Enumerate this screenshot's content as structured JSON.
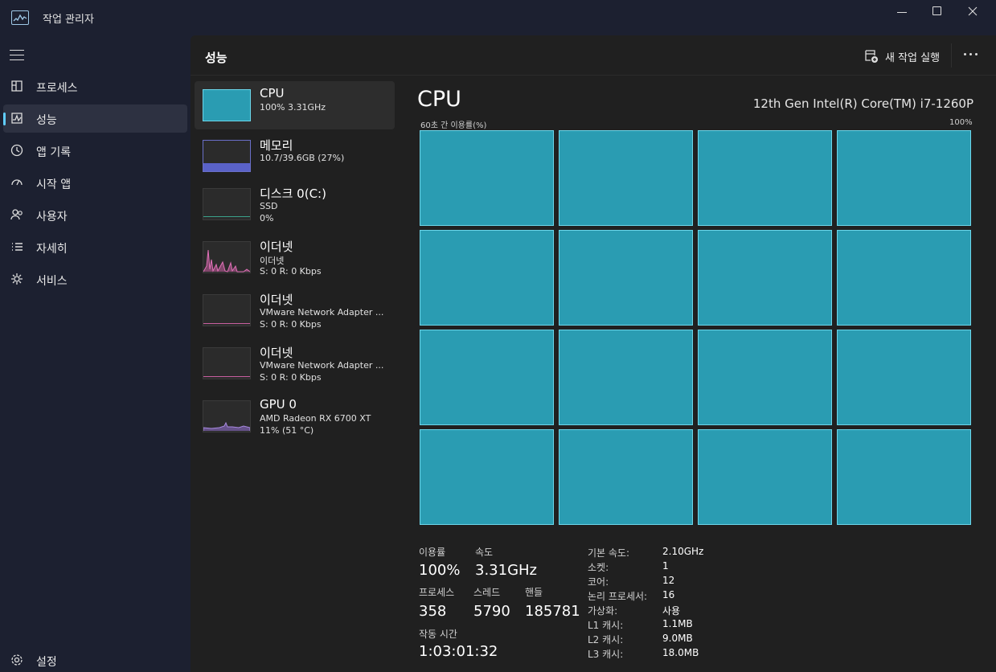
{
  "window": {
    "title": "작업 관리자"
  },
  "nav": {
    "items": [
      {
        "label": "프로세스",
        "icon": "processes-icon"
      },
      {
        "label": "성능",
        "icon": "performance-icon"
      },
      {
        "label": "앱 기록",
        "icon": "app-history-icon"
      },
      {
        "label": "시작 앱",
        "icon": "startup-icon"
      },
      {
        "label": "사용자",
        "icon": "users-icon"
      },
      {
        "label": "자세히",
        "icon": "details-icon"
      },
      {
        "label": "서비스",
        "icon": "services-icon"
      }
    ],
    "active_index": 1,
    "settings_label": "설정"
  },
  "header": {
    "title": "성능",
    "new_task_label": "새 작업 실행"
  },
  "devices": [
    {
      "name": "CPU",
      "sub1": "100%  3.31GHz",
      "sub2": ""
    },
    {
      "name": "메모리",
      "sub1": "10.7/39.6GB (27%)",
      "sub2": ""
    },
    {
      "name": "디스크 0(C:)",
      "sub1": "SSD",
      "sub2": "0%"
    },
    {
      "name": "이더넷",
      "sub1": "이더넷",
      "sub2": "S: 0  R: 0 Kbps"
    },
    {
      "name": "이더넷",
      "sub1": "VMware Network Adapter ...",
      "sub2": "S: 0  R: 0 Kbps"
    },
    {
      "name": "이더넷",
      "sub1": "VMware Network Adapter ...",
      "sub2": "S: 0  R: 0 Kbps"
    },
    {
      "name": "GPU 0",
      "sub1": "AMD Radeon RX 6700 XT",
      "sub2": "11% (51 °C)"
    }
  ],
  "cpu": {
    "title": "CPU",
    "model": "12th Gen Intel(R) Core(TM) i7-1260P",
    "graph_caption": "60초 간 이용률(%)",
    "graph_max": "100%",
    "logical_processor_graphs": 16,
    "graph_color": "#2a9cb2",
    "stats": {
      "utilization_label": "이용률",
      "utilization": "100%",
      "speed_label": "속도",
      "speed": "3.31GHz",
      "processes_label": "프로세스",
      "processes": "358",
      "threads_label": "스레드",
      "threads": "5790",
      "handles_label": "핸들",
      "handles": "185781",
      "uptime_label": "작동 시간",
      "uptime": "1:03:01:32"
    },
    "details": [
      {
        "key": "기본 속도:",
        "value": "2.10GHz"
      },
      {
        "key": "소켓:",
        "value": "1"
      },
      {
        "key": "코어:",
        "value": "12"
      },
      {
        "key": "논리 프로세서:",
        "value": "16"
      },
      {
        "key": "가상화:",
        "value": "사용"
      },
      {
        "key": "L1 캐시:",
        "value": "1.1MB"
      },
      {
        "key": "L2 캐시:",
        "value": "9.0MB"
      },
      {
        "key": "L3 캐시:",
        "value": "18.0MB"
      }
    ]
  }
}
